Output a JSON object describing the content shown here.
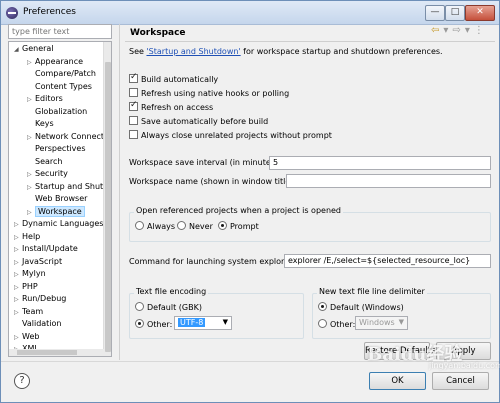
{
  "window": {
    "title": "Preferences",
    "controls": {
      "minimize": "—",
      "maximize": "□",
      "close": "✕"
    }
  },
  "filter": {
    "placeholder": "type filter text"
  },
  "tree": {
    "items": [
      {
        "label": "General",
        "expanded": true
      },
      {
        "label": "Appearance"
      },
      {
        "label": "Compare/Patch"
      },
      {
        "label": "Content Types"
      },
      {
        "label": "Editors"
      },
      {
        "label": "Globalization"
      },
      {
        "label": "Keys"
      },
      {
        "label": "Network Connectio"
      },
      {
        "label": "Perspectives"
      },
      {
        "label": "Search"
      },
      {
        "label": "Security"
      },
      {
        "label": "Startup and Shutd"
      },
      {
        "label": "Web Browser"
      },
      {
        "label": "Workspace",
        "selected": true
      },
      {
        "label": "Dynamic Languages"
      },
      {
        "label": "Help"
      },
      {
        "label": "Install/Update"
      },
      {
        "label": "JavaScript"
      },
      {
        "label": "Mylyn"
      },
      {
        "label": "PHP"
      },
      {
        "label": "Run/Debug"
      },
      {
        "label": "Team"
      },
      {
        "label": "Validation"
      },
      {
        "label": "Web"
      },
      {
        "label": "XML"
      }
    ]
  },
  "panel": {
    "title": "Workspace",
    "see_prefix": "See ",
    "see_link": "'Startup and Shutdown'",
    "see_suffix": " for workspace startup and shutdown preferences.",
    "checkboxes": [
      {
        "label": "Build automatically",
        "checked": true
      },
      {
        "label": "Refresh using native hooks or polling",
        "checked": false
      },
      {
        "label": "Refresh on access",
        "checked": true
      },
      {
        "label": "Save automatically before build",
        "checked": false
      },
      {
        "label": "Always close unrelated projects without prompt",
        "checked": false
      }
    ],
    "save_interval_label": "Workspace save interval (in minutes):",
    "save_interval_value": "5",
    "ws_name_label": "Workspace name (shown in window title):",
    "ws_name_value": "",
    "open_projects": {
      "title": "Open referenced projects when a project is opened",
      "options": [
        "Always",
        "Never",
        "Prompt"
      ],
      "selected": "Prompt"
    },
    "explorer_label": "Command for launching system explorer:",
    "explorer_value": "explorer /E,/select=${selected_resource_loc}",
    "encoding": {
      "title": "Text file encoding",
      "default_label": "Default (GBK)",
      "other_label": "Other:",
      "other_value": "UTF-8",
      "selected": "Other"
    },
    "line_delimiter": {
      "title": "New text file line delimiter",
      "default_label": "Default (Windows)",
      "other_label": "Other:",
      "other_value": "Windows",
      "selected": "Default"
    },
    "restore_defaults": "Restore Defaults",
    "apply": "Apply"
  },
  "footer": {
    "help_icon": "?",
    "ok": "OK",
    "cancel": "Cancel"
  },
  "watermark": {
    "main": "Baidu经验",
    "sub": "jingyan.baidu.com"
  }
}
